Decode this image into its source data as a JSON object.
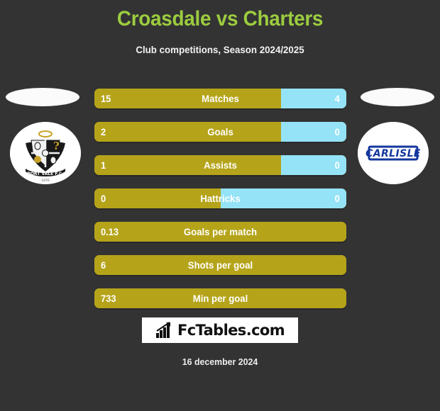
{
  "header": {
    "title": "Croasdale vs Charters",
    "subtitle": "Club competitions, Season 2024/2025"
  },
  "colors": {
    "background": "#333333",
    "title": "#9ccc3f",
    "home_bar": "#b5a41a",
    "away_bar": "#95e3f7",
    "text": "#ffffff"
  },
  "teams": {
    "home": {
      "crest_name": "port-vale-fc-crest",
      "crest_text": "PORT VALE F.C.",
      "crest_year": "1876"
    },
    "away": {
      "crest_name": "carlisle-crest",
      "crest_text": "CARLISLE"
    }
  },
  "footer": {
    "brand": "FcTables.com",
    "brand_icon": "bar-chart-arrow-icon",
    "date": "16 december 2024"
  },
  "chart_data": {
    "type": "bar",
    "title": "Croasdale vs Charters",
    "subtitle": "Club competitions, Season 2024/2025",
    "orientation": "horizontal-paired",
    "series": [
      {
        "name": "Croasdale",
        "side": "left",
        "color": "#b5a41a"
      },
      {
        "name": "Charters",
        "side": "right",
        "color": "#95e3f7"
      }
    ],
    "categories": [
      "Matches",
      "Goals",
      "Assists",
      "Hattricks",
      "Goals per match",
      "Shots per goal",
      "Min per goal"
    ],
    "rows": [
      {
        "label": "Matches",
        "home": "15",
        "away": "4",
        "home_pct": 74,
        "paired": true
      },
      {
        "label": "Goals",
        "home": "2",
        "away": "0",
        "home_pct": 74,
        "paired": true
      },
      {
        "label": "Assists",
        "home": "1",
        "away": "0",
        "home_pct": 74,
        "paired": true
      },
      {
        "label": "Hattricks",
        "home": "0",
        "away": "0",
        "home_pct": 50,
        "paired": true
      },
      {
        "label": "Goals per match",
        "home": "0.13",
        "away": "",
        "home_pct": 100,
        "paired": false
      },
      {
        "label": "Shots per goal",
        "home": "6",
        "away": "",
        "home_pct": 100,
        "paired": false
      },
      {
        "label": "Min per goal",
        "home": "733",
        "away": "",
        "home_pct": 100,
        "paired": false
      }
    ]
  }
}
